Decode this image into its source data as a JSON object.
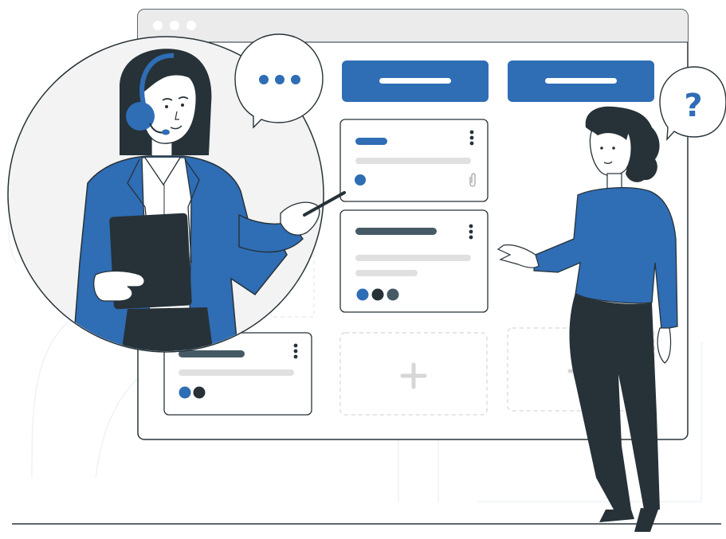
{
  "illustration": {
    "speech_bubble_glyph": "?",
    "palette": {
      "brand_blue": "#2f6db5",
      "dark_navy": "#263238",
      "mid_grey": "#455a64",
      "light_grey": "#e0e0e0",
      "frame_grey": "#ebebeb",
      "skin": "#ffffff"
    },
    "icons": [
      "window-dots-icon",
      "kebab-menu-icon",
      "paperclip-icon",
      "plus-icon",
      "headset-icon",
      "tablet-icon",
      "stylus-icon",
      "ellipsis-icon",
      "question-icon"
    ]
  }
}
